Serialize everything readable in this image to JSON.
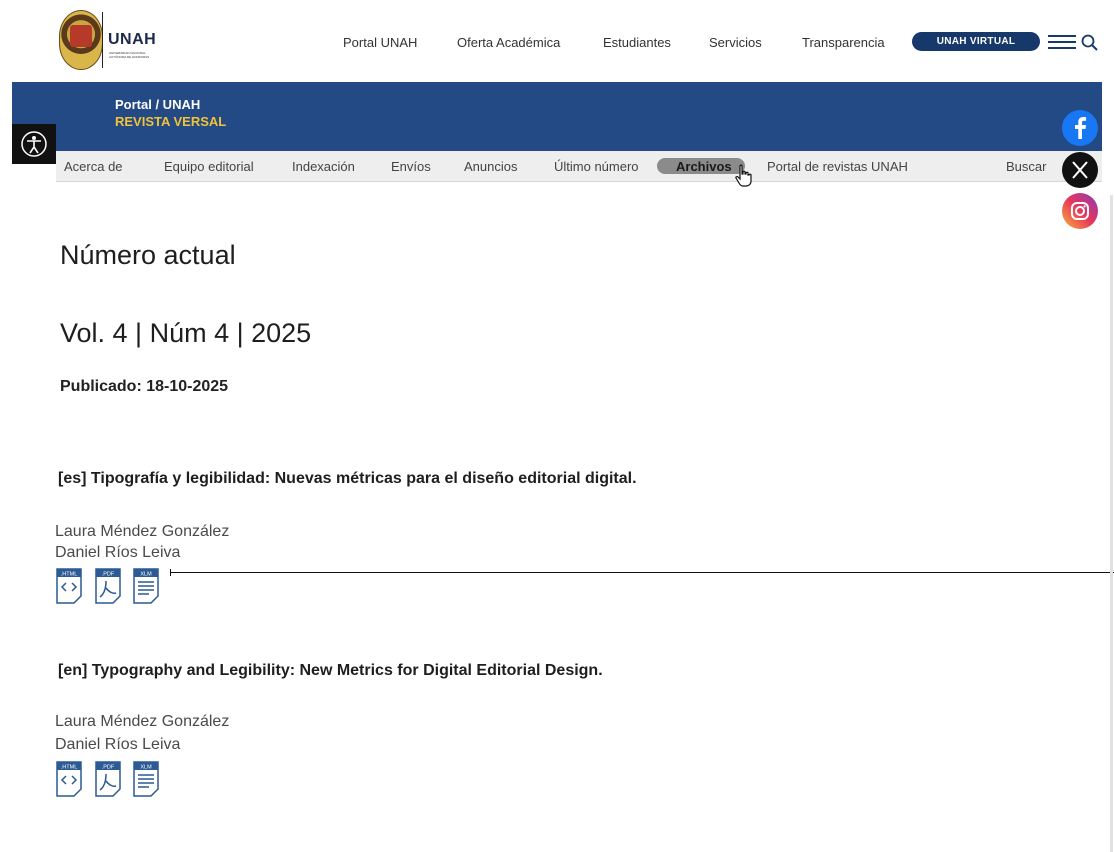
{
  "header": {
    "logo_text": "UNAH",
    "logo_subtext": "UNIVERSIDAD NACIONAL AUTÓNOMA DE HONDURAS",
    "nav": [
      "Portal UNAH",
      "Oferta Académica",
      "Estudiantes",
      "Servicios",
      "Transparencia"
    ],
    "virtual_button": "UNAH VIRTUAL"
  },
  "banner": {
    "breadcrumb": "Portal / UNAH",
    "journal": "REVISTA VERSAL"
  },
  "subnav": {
    "items": [
      "Acerca de",
      "Equipo editorial",
      "Indexación",
      "Envíos",
      "Anuncios",
      "Último número",
      "Archivos",
      "Portal de revistas UNAH"
    ],
    "search": "Buscar",
    "active": "Archivos"
  },
  "main": {
    "heading": "Número actual",
    "volume": "Vol. 4 | Núm 4 | 2025",
    "published": "Publicado: 18-10-2025",
    "articles": [
      {
        "title": "[es] Tipografía y legibilidad: Nuevas métricas para el diseño editorial digital.",
        "authors": [
          "Laura Méndez González",
          "Daniel Ríos Leiva"
        ],
        "files": [
          ".HTML",
          ".PDF",
          "XLM"
        ]
      },
      {
        "title": "[en] Typography and Legibility: New Metrics for Digital Editorial Design.",
        "authors": [
          "Laura Méndez González",
          "Daniel Ríos Leiva"
        ],
        "files": [
          ".HTML",
          ".PDF",
          "XLM"
        ]
      }
    ]
  },
  "social": [
    "facebook-icon",
    "x-icon",
    "instagram-icon"
  ],
  "colors": {
    "brand_blue": "#234a85",
    "brand_gold": "#f2c23a",
    "nav_bg": "#eeeeee",
    "active_pill": "#8b8b8b"
  }
}
